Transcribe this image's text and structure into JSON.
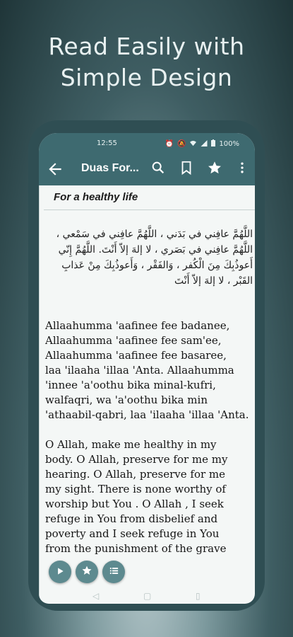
{
  "headline": {
    "line1": "Read Easily with",
    "line2": "Simple Design"
  },
  "status_bar": {
    "time": "12:55",
    "battery": "100%",
    "icons": [
      "alarm-icon",
      "mute-icon",
      "wifi-icon",
      "signal-icon",
      "battery-icon"
    ]
  },
  "app_bar": {
    "title": "Duas For...",
    "actions": [
      "back-icon",
      "search-icon",
      "bookmark-icon",
      "star-icon",
      "more-vert-icon"
    ]
  },
  "dua": {
    "section_title": "For a healthy life",
    "arabic_lines": [
      "اللَّهُمَّ عافِني في بَدَني ، اللَّهُمَّ عافِني في سَمْعي ،",
      "اللَّهُمَّ عافِني في بَصَري ، لا إلهَ إلاّ أَنْتَ. اللَّهُمَّ إِنّي",
      "أَعوذُبِكَ مِنَ الْكُفر ، وَالفَقْر ، وَأَعوذُبِكَ مِنْ عَذابِ",
      "القَبْر ، لا إلهَ إلاّ أَنْتَ"
    ],
    "transliteration_lines": [
      "Allaahumma 'aafinee fee badanee,",
      "Allaahumma 'aafinee fee sam'ee,",
      "Allaahumma 'aafinee fee basaree,",
      "laa 'ilaaha 'illaa 'Anta. Allaahumma",
      "'innee 'a'oothu bika minal-kufri,",
      "walfaqri, wa 'a'oothu bika min",
      "'athaabil-qabri, laa 'ilaaha 'illaa 'Anta."
    ],
    "translation_lines": [
      "O Allah, make me healthy in my",
      "body. O Allah, preserve for me my",
      "hearing. O Allah, preserve for me",
      "my sight. There is none worthy of",
      "worship but You . O Allah , I seek",
      "refuge in You from disbelief and",
      "poverty and I seek refuge in You",
      "from the punishment of the grave"
    ]
  },
  "fabs": [
    "play-icon",
    "star-icon",
    "list-icon"
  ],
  "colors": {
    "appbar": "#3e6a70",
    "fab": "#5d8a8f",
    "phone_frame": "#2f4e53"
  }
}
